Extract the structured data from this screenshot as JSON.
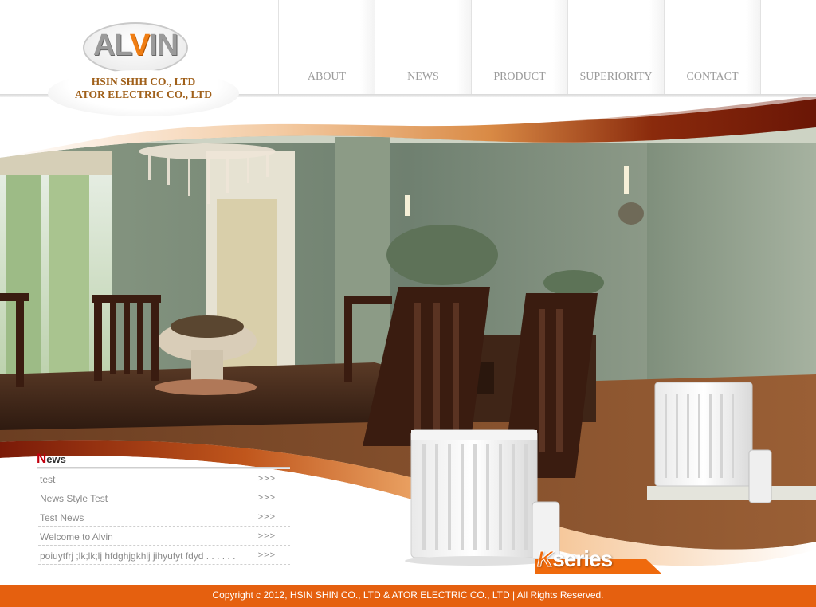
{
  "logo": {
    "brand_pre": "AL",
    "brand_mid": "V",
    "brand_post": "IN",
    "company_line1": "HSIN SHIH CO., LTD",
    "company_line2": "ATOR ELECTRIC CO., LTD"
  },
  "nav": {
    "items": [
      {
        "label": "ABOUT"
      },
      {
        "label": "NEWS"
      },
      {
        "label": "PRODUCT"
      },
      {
        "label": "SUPERIORITY"
      },
      {
        "label": "CONTACT"
      }
    ]
  },
  "news": {
    "title_first": "N",
    "title_rest": "ews",
    "more_marker": ">>>",
    "items": [
      {
        "title": "test"
      },
      {
        "title": "News Style Test"
      },
      {
        "title": "Test News"
      },
      {
        "title": "Welcome to Alvin"
      },
      {
        "title": "poiuytfrj ;lk;lk;lj hfdghjgkhlj jihyufyt fdyd . . . . . ."
      }
    ]
  },
  "product": {
    "series_letter": "K",
    "series_word": "series"
  },
  "footer": {
    "copyright": "Copyright c 2012, HSIN SHIN CO., LTD & ATOR ELECTRIC CO., LTD | All Rights Reserved."
  },
  "colors": {
    "accent_orange": "#e5600f",
    "brand_orange": "#f07e14",
    "news_red": "#c2000e",
    "swoosh_brown": "#7a1a08"
  },
  "icons": {
    "radiator": "radiator-image",
    "hero": "dining-room-photo"
  }
}
